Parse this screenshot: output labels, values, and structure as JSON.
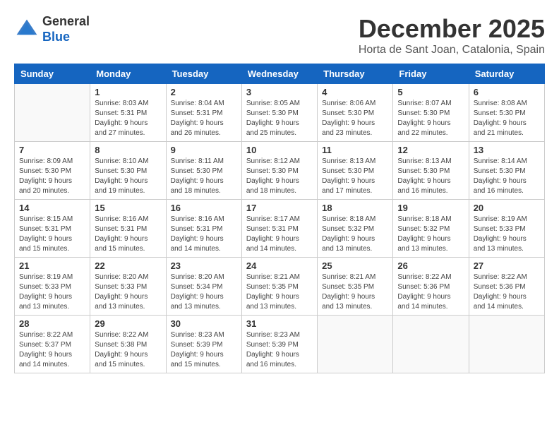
{
  "header": {
    "logo_line1": "General",
    "logo_line2": "Blue",
    "month": "December 2025",
    "location": "Horta de Sant Joan, Catalonia, Spain"
  },
  "weekdays": [
    "Sunday",
    "Monday",
    "Tuesday",
    "Wednesday",
    "Thursday",
    "Friday",
    "Saturday"
  ],
  "weeks": [
    [
      {
        "day": "",
        "info": ""
      },
      {
        "day": "1",
        "info": "Sunrise: 8:03 AM\nSunset: 5:31 PM\nDaylight: 9 hours\nand 27 minutes."
      },
      {
        "day": "2",
        "info": "Sunrise: 8:04 AM\nSunset: 5:31 PM\nDaylight: 9 hours\nand 26 minutes."
      },
      {
        "day": "3",
        "info": "Sunrise: 8:05 AM\nSunset: 5:30 PM\nDaylight: 9 hours\nand 25 minutes."
      },
      {
        "day": "4",
        "info": "Sunrise: 8:06 AM\nSunset: 5:30 PM\nDaylight: 9 hours\nand 23 minutes."
      },
      {
        "day": "5",
        "info": "Sunrise: 8:07 AM\nSunset: 5:30 PM\nDaylight: 9 hours\nand 22 minutes."
      },
      {
        "day": "6",
        "info": "Sunrise: 8:08 AM\nSunset: 5:30 PM\nDaylight: 9 hours\nand 21 minutes."
      }
    ],
    [
      {
        "day": "7",
        "info": "Sunrise: 8:09 AM\nSunset: 5:30 PM\nDaylight: 9 hours\nand 20 minutes."
      },
      {
        "day": "8",
        "info": "Sunrise: 8:10 AM\nSunset: 5:30 PM\nDaylight: 9 hours\nand 19 minutes."
      },
      {
        "day": "9",
        "info": "Sunrise: 8:11 AM\nSunset: 5:30 PM\nDaylight: 9 hours\nand 18 minutes."
      },
      {
        "day": "10",
        "info": "Sunrise: 8:12 AM\nSunset: 5:30 PM\nDaylight: 9 hours\nand 18 minutes."
      },
      {
        "day": "11",
        "info": "Sunrise: 8:13 AM\nSunset: 5:30 PM\nDaylight: 9 hours\nand 17 minutes."
      },
      {
        "day": "12",
        "info": "Sunrise: 8:13 AM\nSunset: 5:30 PM\nDaylight: 9 hours\nand 16 minutes."
      },
      {
        "day": "13",
        "info": "Sunrise: 8:14 AM\nSunset: 5:30 PM\nDaylight: 9 hours\nand 16 minutes."
      }
    ],
    [
      {
        "day": "14",
        "info": "Sunrise: 8:15 AM\nSunset: 5:31 PM\nDaylight: 9 hours\nand 15 minutes."
      },
      {
        "day": "15",
        "info": "Sunrise: 8:16 AM\nSunset: 5:31 PM\nDaylight: 9 hours\nand 15 minutes."
      },
      {
        "day": "16",
        "info": "Sunrise: 8:16 AM\nSunset: 5:31 PM\nDaylight: 9 hours\nand 14 minutes."
      },
      {
        "day": "17",
        "info": "Sunrise: 8:17 AM\nSunset: 5:31 PM\nDaylight: 9 hours\nand 14 minutes."
      },
      {
        "day": "18",
        "info": "Sunrise: 8:18 AM\nSunset: 5:32 PM\nDaylight: 9 hours\nand 13 minutes."
      },
      {
        "day": "19",
        "info": "Sunrise: 8:18 AM\nSunset: 5:32 PM\nDaylight: 9 hours\nand 13 minutes."
      },
      {
        "day": "20",
        "info": "Sunrise: 8:19 AM\nSunset: 5:33 PM\nDaylight: 9 hours\nand 13 minutes."
      }
    ],
    [
      {
        "day": "21",
        "info": "Sunrise: 8:19 AM\nSunset: 5:33 PM\nDaylight: 9 hours\nand 13 minutes."
      },
      {
        "day": "22",
        "info": "Sunrise: 8:20 AM\nSunset: 5:33 PM\nDaylight: 9 hours\nand 13 minutes."
      },
      {
        "day": "23",
        "info": "Sunrise: 8:20 AM\nSunset: 5:34 PM\nDaylight: 9 hours\nand 13 minutes."
      },
      {
        "day": "24",
        "info": "Sunrise: 8:21 AM\nSunset: 5:35 PM\nDaylight: 9 hours\nand 13 minutes."
      },
      {
        "day": "25",
        "info": "Sunrise: 8:21 AM\nSunset: 5:35 PM\nDaylight: 9 hours\nand 13 minutes."
      },
      {
        "day": "26",
        "info": "Sunrise: 8:22 AM\nSunset: 5:36 PM\nDaylight: 9 hours\nand 14 minutes."
      },
      {
        "day": "27",
        "info": "Sunrise: 8:22 AM\nSunset: 5:36 PM\nDaylight: 9 hours\nand 14 minutes."
      }
    ],
    [
      {
        "day": "28",
        "info": "Sunrise: 8:22 AM\nSunset: 5:37 PM\nDaylight: 9 hours\nand 14 minutes."
      },
      {
        "day": "29",
        "info": "Sunrise: 8:22 AM\nSunset: 5:38 PM\nDaylight: 9 hours\nand 15 minutes."
      },
      {
        "day": "30",
        "info": "Sunrise: 8:23 AM\nSunset: 5:39 PM\nDaylight: 9 hours\nand 15 minutes."
      },
      {
        "day": "31",
        "info": "Sunrise: 8:23 AM\nSunset: 5:39 PM\nDaylight: 9 hours\nand 16 minutes."
      },
      {
        "day": "",
        "info": ""
      },
      {
        "day": "",
        "info": ""
      },
      {
        "day": "",
        "info": ""
      }
    ]
  ]
}
